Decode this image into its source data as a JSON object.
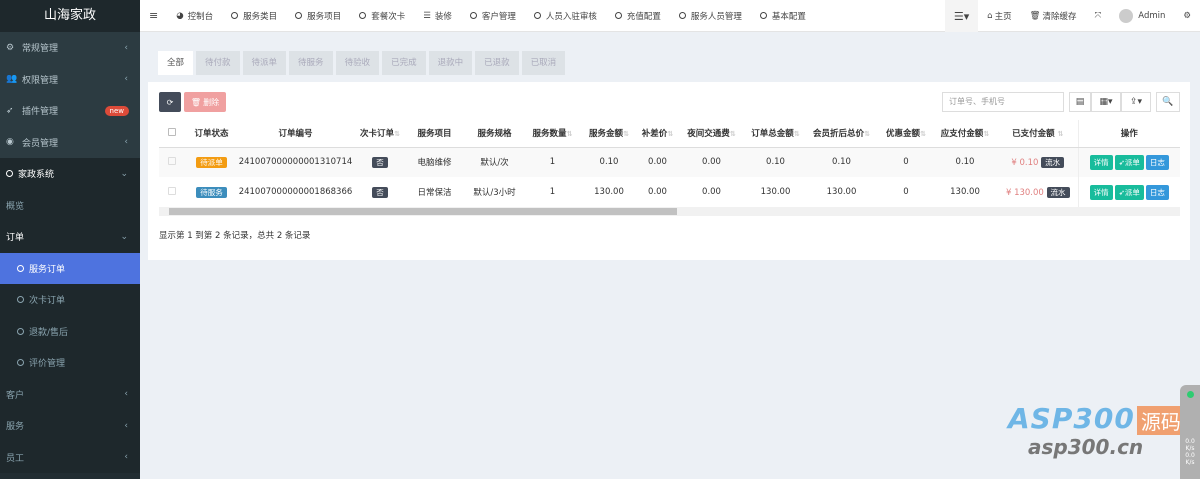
{
  "app": {
    "title": "山海家政"
  },
  "sidebar": {
    "items": [
      {
        "label": "常规管理",
        "icon": "cogs-icon"
      },
      {
        "label": "权限管理",
        "icon": "users-icon"
      },
      {
        "label": "插件管理",
        "icon": "rocket-icon",
        "badge": "new"
      },
      {
        "label": "会员管理",
        "icon": "user-circle-icon"
      },
      {
        "label": "家政系统",
        "icon": "circle-icon"
      },
      {
        "label": "概览"
      },
      {
        "label": "订单"
      },
      {
        "label": "服务订单",
        "active": true
      },
      {
        "label": "次卡订单"
      },
      {
        "label": "退款/售后"
      },
      {
        "label": "评价管理"
      },
      {
        "label": "客户"
      },
      {
        "label": "服务"
      },
      {
        "label": "员工"
      }
    ]
  },
  "topnav": {
    "items": [
      {
        "label": "控制台",
        "icon": "dashboard-icon"
      },
      {
        "label": "服务类目",
        "icon": "circle-icon"
      },
      {
        "label": "服务项目",
        "icon": "circle-icon"
      },
      {
        "label": "套餐次卡",
        "icon": "circle-icon"
      },
      {
        "label": "装修",
        "icon": "list-icon"
      },
      {
        "label": "客户管理",
        "icon": "circle-icon"
      },
      {
        "label": "人员入驻审核",
        "icon": "circle-icon"
      },
      {
        "label": "充值配置",
        "icon": "circle-icon"
      },
      {
        "label": "服务人员管理",
        "icon": "circle-icon"
      },
      {
        "label": "基本配置",
        "icon": "circle-icon"
      }
    ],
    "home": "主页",
    "clear_cache": "清除缓存",
    "user": "Admin"
  },
  "tabs": [
    "全部",
    "待付款",
    "待派单",
    "待服务",
    "待验收",
    "已完成",
    "退款中",
    "已退款",
    "已取消"
  ],
  "toolbar": {
    "delete": "删除",
    "search_placeholder": "订单号、手机号"
  },
  "table": {
    "columns": [
      "订单状态",
      "订单编号",
      "次卡订单",
      "服务项目",
      "服务规格",
      "服务数量",
      "服务金额",
      "补差价",
      "夜间交通费",
      "订单总金额",
      "会员折后总价",
      "优惠金额",
      "应支付金额",
      "已支付金额",
      "操作"
    ],
    "rows": [
      {
        "status": "待派单",
        "status_color": "#f39c12",
        "no": "241007000000001310714",
        "card": "否",
        "item": "电脑维修",
        "spec": "默认/次",
        "qty": "1",
        "amount": "0.10",
        "diff": "0.00",
        "night": "0.00",
        "total": "0.10",
        "member": "0.10",
        "discount": "0",
        "payable": "0.10",
        "paid": "¥ 0.10"
      },
      {
        "status": "待服务",
        "status_color": "#3c8dbc",
        "no": "241007000000001868366",
        "card": "否",
        "item": "日常保洁",
        "spec": "默认/3小时",
        "qty": "1",
        "amount": "130.00",
        "diff": "0.00",
        "night": "0.00",
        "total": "130.00",
        "member": "130.00",
        "discount": "0",
        "payable": "130.00",
        "paid": "¥ 130.00"
      }
    ],
    "flow_label": "流水",
    "actions": [
      "详情",
      "派单",
      "日志"
    ]
  },
  "footer": "显示第 1 到第 2 条记录，总共 2 条记录",
  "watermark": {
    "brand": "ASP300",
    "tag": "源码",
    "url": "asp300.cn"
  },
  "widget": {
    "v1": "0.0",
    "u1": "K/s",
    "v2": "0.0",
    "u2": "K/s"
  }
}
